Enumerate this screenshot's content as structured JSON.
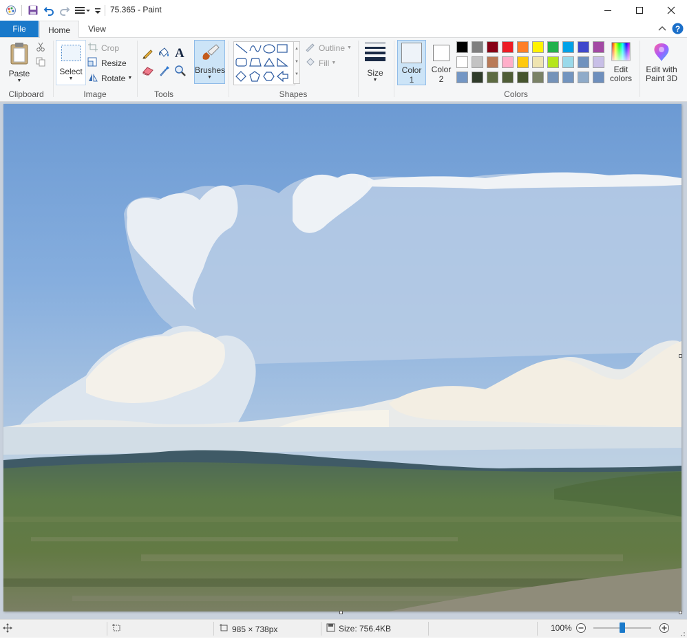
{
  "window": {
    "title": "75.365 - Paint"
  },
  "tabs": {
    "file": "File",
    "home": "Home",
    "view": "View"
  },
  "clipboard": {
    "label": "Clipboard",
    "paste": "Paste"
  },
  "image": {
    "label": "Image",
    "select": "Select",
    "crop": "Crop",
    "resize": "Resize",
    "rotate": "Rotate"
  },
  "tools": {
    "label": "Tools"
  },
  "brushes": {
    "label": "Brushes"
  },
  "shapes": {
    "label": "Shapes",
    "outline": "Outline",
    "fill": "Fill"
  },
  "size": {
    "label": "Size"
  },
  "colors": {
    "label": "Colors",
    "color1_label": "Color",
    "color1_num": "1",
    "color2_label": "Color",
    "color2_num": "2",
    "color1_value": "#eef3f9",
    "color2_value": "#ffffff",
    "edit_label_1": "Edit",
    "edit_label_2": "colors",
    "palette_row1": [
      "#000000",
      "#7f7f7f",
      "#880015",
      "#ed1c24",
      "#ff7f27",
      "#fff200",
      "#22b14c",
      "#00a2e8",
      "#3f48cc",
      "#a349a4"
    ],
    "palette_row2": [
      "#ffffff",
      "#c3c3c3",
      "#b97a57",
      "#ffaec9",
      "#ffc90e",
      "#efe4b0",
      "#b5e61d",
      "#99d9ea",
      "#7092be",
      "#c8bfe7"
    ],
    "palette_row3": [
      "#7396c4",
      "#2f3b2a",
      "#5d6b42",
      "#4f5d36",
      "#46552e",
      "#7a8266",
      "#7593b9",
      "#7294bf",
      "#8fabc9",
      "#6e8fbd"
    ]
  },
  "paint3d": {
    "label_1": "Edit with",
    "label_2": "Paint 3D"
  },
  "status": {
    "dimensions": "985 × 738px",
    "size": "Size: 756.4KB",
    "zoom": "100%",
    "zoom_level": 0.5
  }
}
